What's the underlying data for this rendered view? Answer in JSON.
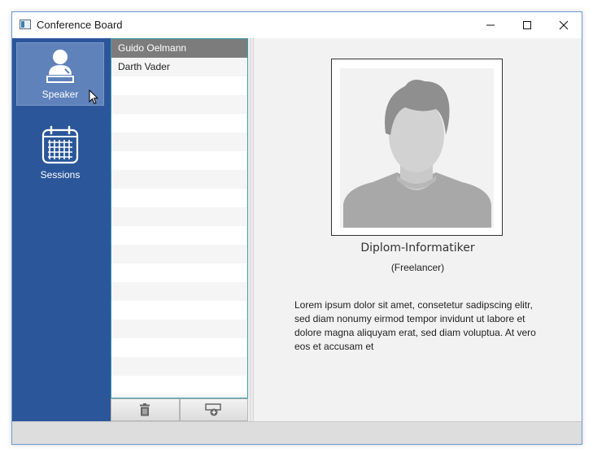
{
  "window": {
    "title": "Conference Board"
  },
  "sidebar": {
    "items": [
      {
        "label": "Speaker",
        "icon": "speaker-icon",
        "selected": true
      },
      {
        "label": "Sessions",
        "icon": "calendar-icon",
        "selected": false
      }
    ]
  },
  "speaker_list": {
    "items": [
      {
        "name": "Guido Oelmann",
        "selected": true
      },
      {
        "name": "Darth Vader",
        "selected": false
      }
    ],
    "toolbar": {
      "delete_icon": "trash-icon",
      "add_icon": "add-speaker-icon"
    }
  },
  "detail": {
    "photo_icon": "avatar-placeholder-icon",
    "degree": "Diplom-Informatiker",
    "employment": "(Freelancer)",
    "bio": "Lorem ipsum dolor sit amet, consetetur sadipscing elitr, sed diam nonumy eirmod tempor invidunt ut labore et dolore magna aliquyam erat, sed diam voluptua. At vero eos et accusam et"
  },
  "colors": {
    "sidebar": "#2b579a",
    "sidebar_selected": "#5f82bb",
    "list_selected": "#7c7c7c",
    "list_border": "#3aa0ab"
  }
}
